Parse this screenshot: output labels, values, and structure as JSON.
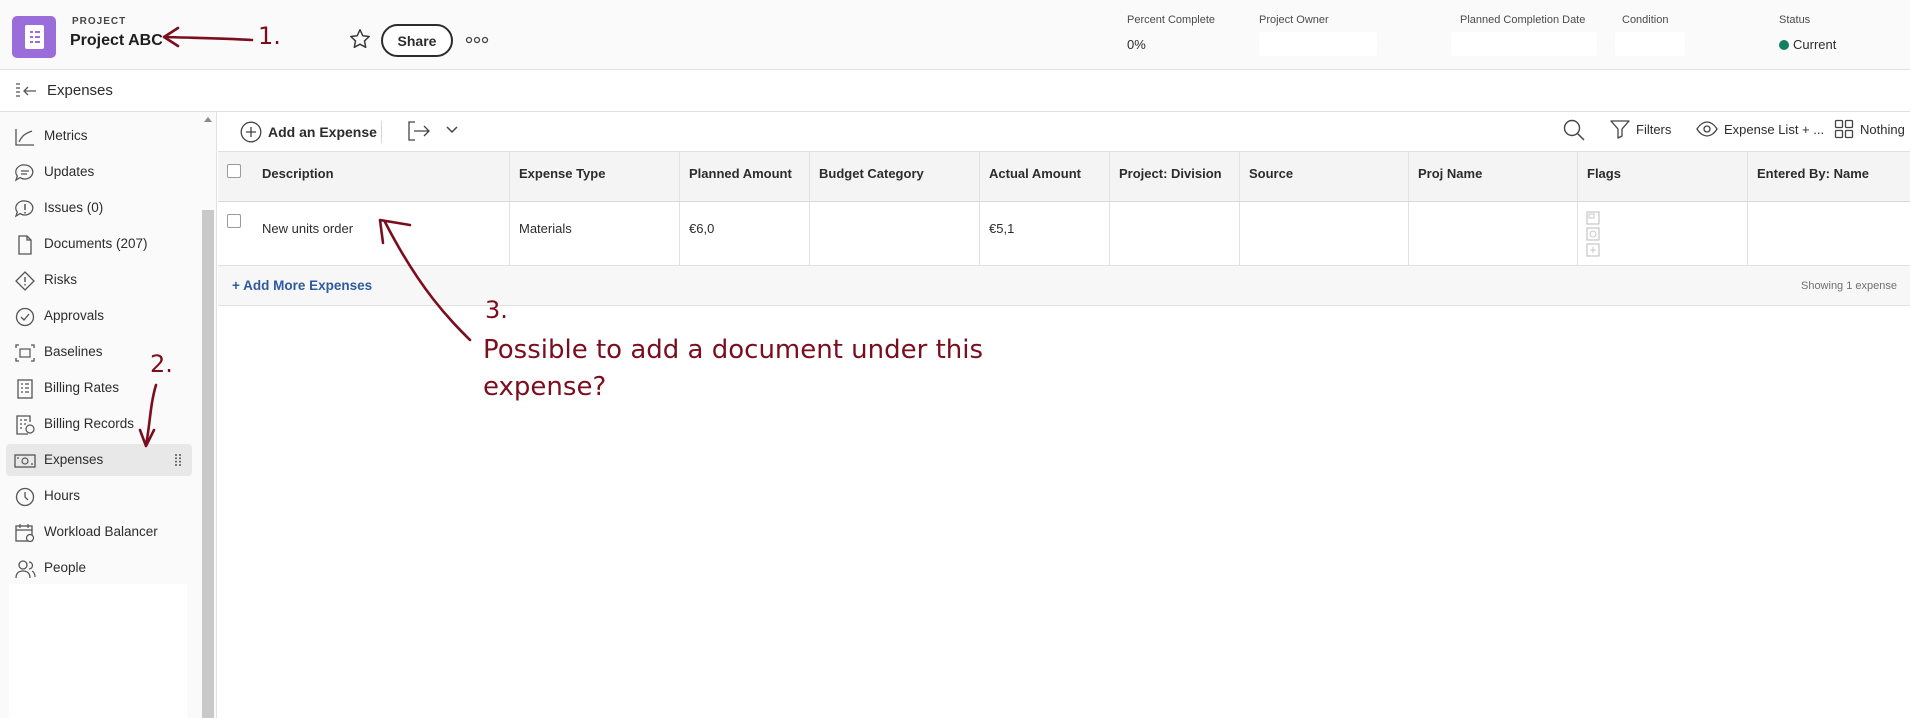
{
  "header": {
    "kind": "PROJECT",
    "name": "Project ABC",
    "share_label": "Share",
    "fields": {
      "percent_complete": {
        "label": "Percent Complete",
        "value": "0%"
      },
      "project_owner": {
        "label": "Project Owner",
        "value": ""
      },
      "planned_completion": {
        "label": "Planned Completion Date",
        "value": ""
      },
      "condition": {
        "label": "Condition",
        "value": ""
      },
      "status": {
        "label": "Status",
        "value": "Current",
        "color": "#12805c"
      }
    },
    "icon_color": "#9a6ddb"
  },
  "subheader": {
    "title": "Expenses"
  },
  "sidebar": {
    "items": [
      {
        "label": "Metrics",
        "icon": "metrics-icon"
      },
      {
        "label": "Updates",
        "icon": "updates-icon"
      },
      {
        "label": "Issues (0)",
        "icon": "issues-icon"
      },
      {
        "label": "Documents (207)",
        "icon": "documents-icon"
      },
      {
        "label": "Risks",
        "icon": "risks-icon"
      },
      {
        "label": "Approvals",
        "icon": "approvals-icon"
      },
      {
        "label": "Baselines",
        "icon": "baselines-icon"
      },
      {
        "label": "Billing Rates",
        "icon": "billing-rates-icon"
      },
      {
        "label": "Billing Records",
        "icon": "billing-records-icon"
      },
      {
        "label": "Expenses",
        "icon": "expenses-icon",
        "active": true
      },
      {
        "label": "Hours",
        "icon": "hours-icon"
      },
      {
        "label": "Workload Balancer",
        "icon": "workload-balancer-icon"
      },
      {
        "label": "People",
        "icon": "people-icon"
      }
    ]
  },
  "toolbar": {
    "add_label": "Add an Expense",
    "filters_label": "Filters",
    "view_label": "Expense List + ...",
    "grouping_label": "Nothing"
  },
  "table": {
    "columns": [
      "Description",
      "Expense Type",
      "Planned Amount",
      "Budget Category",
      "Actual Amount",
      "Project: Division",
      "Source",
      "Proj Name",
      "Flags",
      "Entered By: Name"
    ],
    "rows": [
      [
        "New units order",
        "Materials",
        "€6,0",
        "",
        "€5,1",
        "",
        "",
        "",
        "",
        ""
      ]
    ],
    "add_more_label": "+ Add More Expenses",
    "showing_label": "Showing 1 expense"
  },
  "annotations": {
    "a1": "1.",
    "a2": "2.",
    "a3": "3.",
    "question": "Possible to add a document under this expense?",
    "color": "#7b0e1e"
  }
}
